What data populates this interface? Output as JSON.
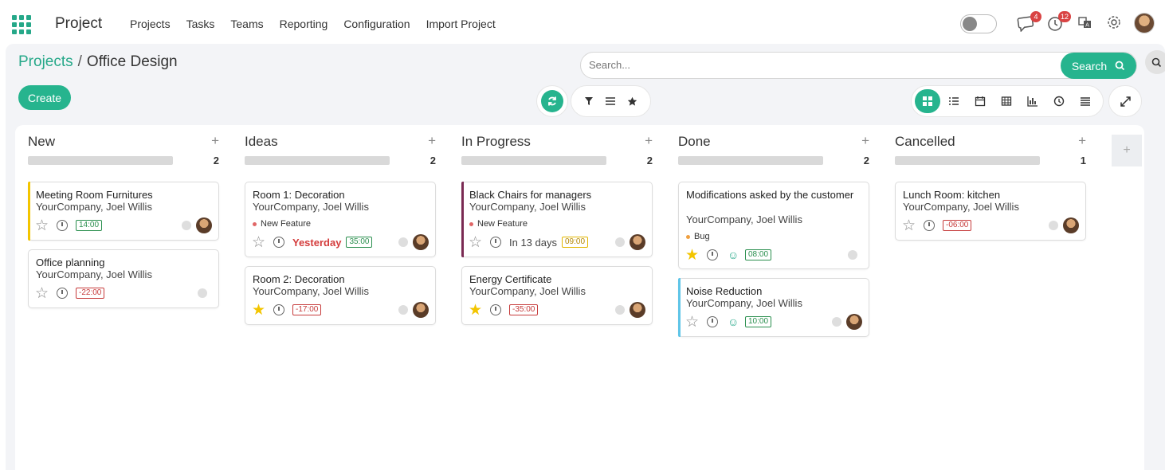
{
  "nav": {
    "brand": "Project",
    "menu": [
      "Projects",
      "Tasks",
      "Teams",
      "Reporting",
      "Configuration",
      "Import Project"
    ],
    "messages_count": "4",
    "activities_count": "12"
  },
  "breadcrumb": {
    "parent": "Projects",
    "sep": "/",
    "current": "Office Design"
  },
  "search": {
    "placeholder": "Search...",
    "button": "Search"
  },
  "toolbar": {
    "create": "Create"
  },
  "columns": [
    {
      "title": "New",
      "count": "2"
    },
    {
      "title": "Ideas",
      "count": "2"
    },
    {
      "title": "In Progress",
      "count": "2"
    },
    {
      "title": "Done",
      "count": "2"
    },
    {
      "title": "Cancelled",
      "count": "1"
    }
  ],
  "cards": {
    "c1": {
      "title": "Meeting Room Furnitures",
      "sub": "YourCompany, Joel Willis",
      "time": "14:00"
    },
    "c2": {
      "title": "Office planning",
      "sub": "YourCompany, Joel Willis",
      "time": "-22:00"
    },
    "c3": {
      "title": "Room 1: Decoration",
      "sub": "YourCompany, Joel Willis",
      "tag": "New Feature",
      "deadline": "Yesterday",
      "time": "35:00"
    },
    "c4": {
      "title": "Room 2: Decoration",
      "sub": "YourCompany, Joel Willis",
      "time": "-17:00"
    },
    "c5": {
      "title": "Black Chairs for managers",
      "sub": "YourCompany, Joel Willis",
      "tag": "New Feature",
      "deadline": "In 13 days",
      "time": "09:00"
    },
    "c6": {
      "title": "Energy Certificate",
      "sub": "YourCompany, Joel Willis",
      "time": "-35:00"
    },
    "c7": {
      "title": "Modifications asked by the customer",
      "sub": "YourCompany, Joel Willis",
      "tag": "Bug",
      "time": "08:00"
    },
    "c8": {
      "title": "Noise Reduction",
      "sub": "YourCompany, Joel Willis",
      "time": "10:00"
    },
    "c9": {
      "title": "Lunch Room: kitchen",
      "sub": "YourCompany, Joel Willis",
      "time": "-06:00"
    }
  },
  "colors": {
    "accent": "#26b48e",
    "danger": "#d43c3c",
    "star": "#f3c500"
  }
}
